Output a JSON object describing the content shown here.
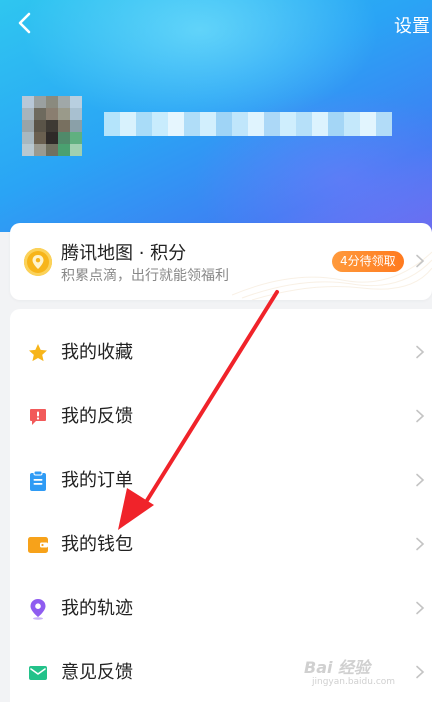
{
  "header": {
    "settings_label": "设置",
    "back_icon": "chevron-left-icon"
  },
  "points_card": {
    "title": "腾讯地图 · 积分",
    "subtitle": "积累点滴，出行就能领福利",
    "badge": "4分待领取",
    "icon": "location-coin-icon",
    "accent_color": "#ff8a2b"
  },
  "menu": {
    "items": [
      {
        "label": "我的收藏",
        "icon": "star-icon",
        "color": "#f7b51a"
      },
      {
        "label": "我的反馈",
        "icon": "feedback-alert-icon",
        "color": "#f25a5a"
      },
      {
        "label": "我的订单",
        "icon": "clipboard-icon",
        "color": "#2f9bf5"
      },
      {
        "label": "我的钱包",
        "icon": "wallet-icon",
        "color": "#f7a21a"
      },
      {
        "label": "我的轨迹",
        "icon": "location-pin-icon",
        "color": "#8f5cf0"
      },
      {
        "label": "意见反馈",
        "icon": "mail-icon",
        "color": "#23c28a"
      }
    ]
  },
  "watermark": {
    "text": "Bai 经验",
    "sub": "jingyan.baidu.com"
  }
}
